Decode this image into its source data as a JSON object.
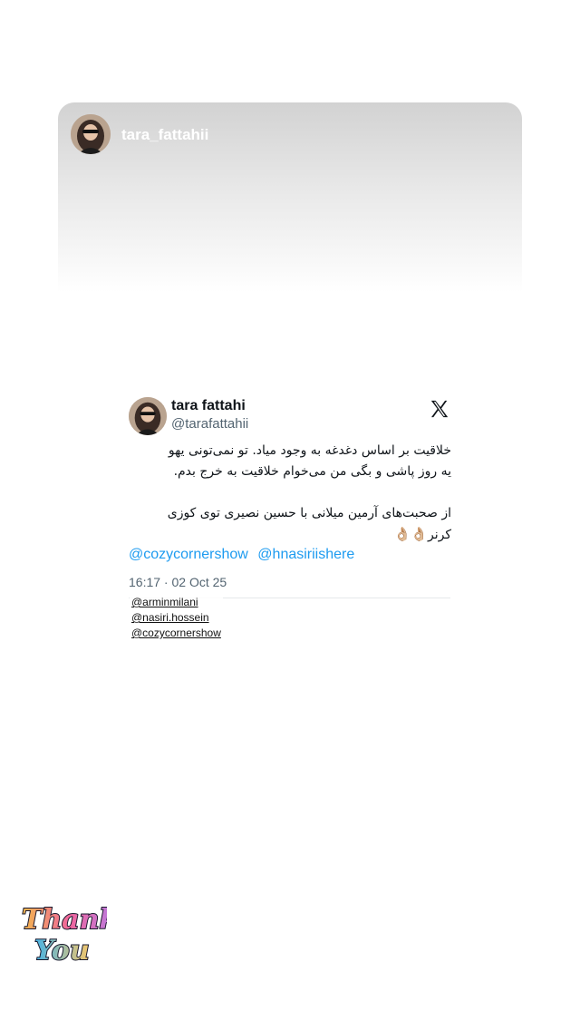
{
  "story": {
    "username": "tara_fattahii"
  },
  "tweet": {
    "display_name": "tara fattahi",
    "handle": "@tarafattahii",
    "body_line1": "خلاقیت بر اساس دغدغه به وجود میاد. تو نمی‌تونی یهو",
    "body_line2": "یه روز پاشی و بگی من می‌خوام خلاقیت به خرج بدم.",
    "body_line3": "از صحبت‌های آرمین میلانی با حسین نصیری توی کوزی",
    "body_line4": "کرنر",
    "emoji": "👌🏼👌🏼",
    "mentions": [
      "@cozycornershow",
      "@hnasiriishere"
    ],
    "timestamp": "16:17 · 02 Oct 25"
  },
  "tags": [
    "@arminmilani",
    "@nasiri.hossein",
    "@cozycornershow"
  ],
  "sticker": {
    "line1": "Thank",
    "line2": "You"
  },
  "colors": {
    "link": "#1d9bf0",
    "meta": "#536471",
    "text": "#0f1419"
  }
}
